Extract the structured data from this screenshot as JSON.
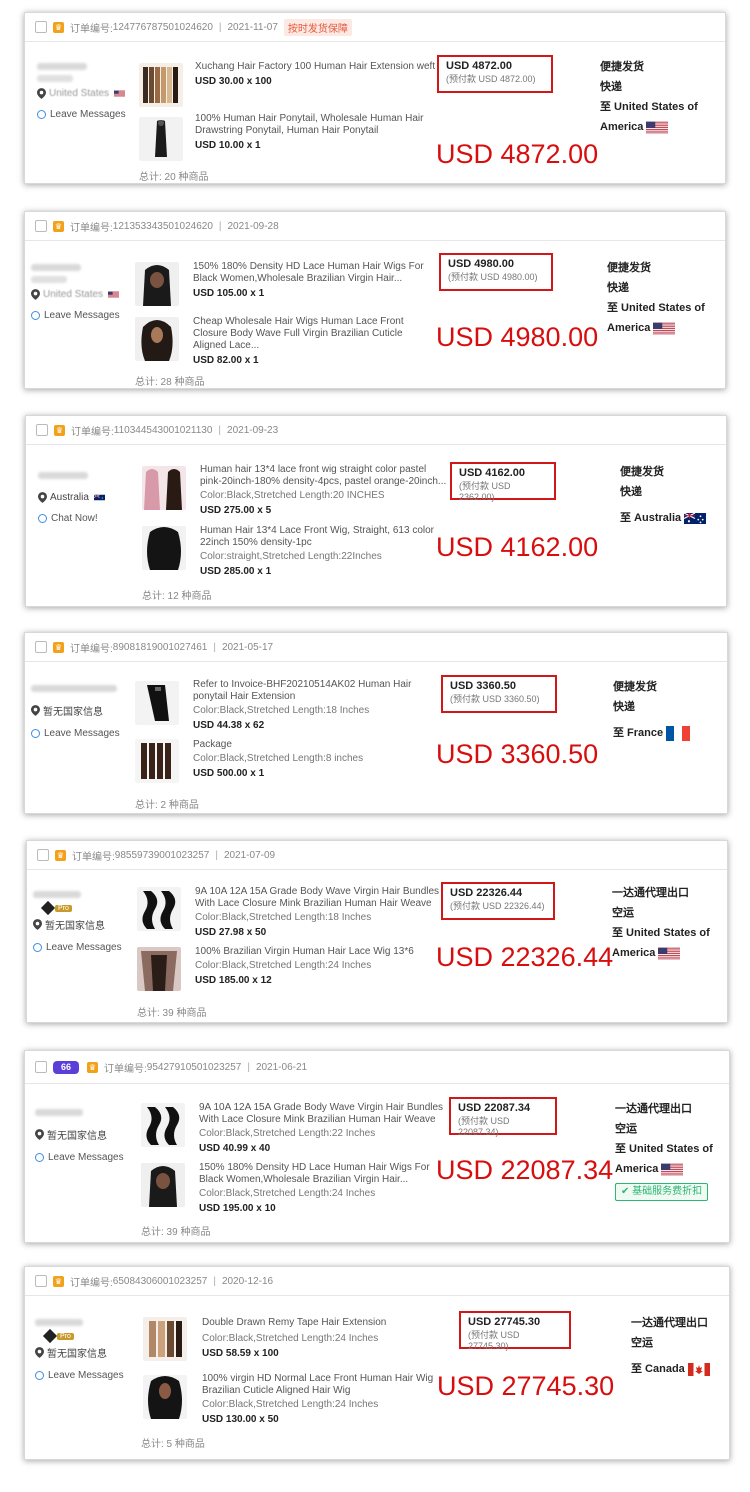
{
  "order_label": "订单编号:",
  "leave_messages": "Leave Messages",
  "chat_now": "Chat Now!",
  "ship_mode_a1": "便捷发货",
  "ship_mode_a2": "快递",
  "ship_mode_b1": "一达通代理出口",
  "ship_mode_b2": "空运",
  "no_country": "暂无国家信息",
  "pro_label": "Pro",
  "orders": [
    {
      "order_no": "124776787501024620",
      "date": "2021-11-07",
      "tag": "按时发货保障",
      "loc": "United States",
      "p1_title": "Xuchang Hair Factory 100 Human Hair Extension weft",
      "p1_attr": "",
      "p1_price": "USD 30.00 x 100",
      "p2_title": "100% Human Hair Ponytail, Wholesale Human Hair Drawstring Ponytail, Human Hair Ponytail",
      "p2_attr": "",
      "p2_price": "USD 10.00 x 1",
      "total": "总计: 20 种商品",
      "price_main": "USD 4872.00",
      "price_pre": "(预付款 USD 4872.00)",
      "big": "USD 4872.00",
      "dest": "至 United States of America"
    },
    {
      "order_no": "121353343501024620",
      "date": "2021-09-28",
      "loc": "United States",
      "p1_title": "150% 180% Density HD Lace Human Hair Wigs For Black Women,Wholesale Brazilian Virgin Hair...",
      "p1_attr": "",
      "p1_price": "USD 105.00 x 1",
      "p2_title": "Cheap Wholesale Hair Wigs Human Lace Front Closure Body Wave Full Virgin Brazilian Cuticle Aligned Lace...",
      "p2_attr": "",
      "p2_price": "USD 82.00 x 1",
      "total": "总计: 28 种商品",
      "price_main": "USD 4980.00",
      "price_pre": "(预付款 USD 4980.00)",
      "big": "USD 4980.00",
      "dest": "至 United States of America"
    },
    {
      "order_no": "110344543001021130",
      "date": "2021-09-23",
      "loc": "Australia",
      "p1_title": "Human hair 13*4 lace front wig straight color pastel pink-20inch-180% density-4pcs, pastel orange-20inch...",
      "p1_attr": "Color:Black,Stretched Length:20 INCHES",
      "p1_price": "USD 275.00 x 5",
      "p2_title": "Human Hair 13*4 Lace Front Wig, Straight, 613 color 22inch 150% density-1pc",
      "p2_attr": "Color:straight,Stretched Length:22Inches",
      "p2_price": "USD 285.00 x 1",
      "total": "总计: 12 种商品",
      "price_main": "USD 4162.00",
      "price_pre": "(预付款 USD 2362.00)",
      "big": "USD 4162.00",
      "dest": "至 Australia"
    },
    {
      "order_no": "89081819001027461",
      "date": "2021-05-17",
      "p1_title": "Refer to Invoice-BHF20210514AK02 Human Hair ponytail Hair Extension",
      "p1_attr": "Color:Black,Stretched Length:18 Inches",
      "p1_price": "USD 44.38 x 62",
      "p2_title": "Package",
      "p2_attr": "Color:Black,Stretched Length:8 inches",
      "p2_price": "USD 500.00 x 1",
      "total": "总计: 2 种商品",
      "price_main": "USD 3360.50",
      "price_pre": "(预付款 USD 3360.50)",
      "big": "USD 3360.50",
      "dest": "至 France"
    },
    {
      "order_no": "98559739001023257",
      "date": "2021-07-09",
      "p1_title": "9A 10A 12A 15A Grade Body Wave Virgin Hair Bundles With Lace Closure Mink Brazilian Human Hair Weave",
      "p1_attr": "Color:Black,Stretched Length:18 Inches",
      "p1_price": "USD 27.98 x 50",
      "p2_title": "100% Brazilian Virgin Human Hair Lace Wig 13*6",
      "p2_attr": "Color:Black,Stretched Length:24 Inches",
      "p2_price": "USD 185.00 x 12",
      "total": "总计: 39 种商品",
      "price_main": "USD 22326.44",
      "price_pre": "(预付款 USD 22326.44)",
      "big": "USD 22326.44",
      "dest": "至 United States of America"
    },
    {
      "order_no": "95427910501023257",
      "date": "2021-06-21",
      "p1_title": "9A 10A 12A 15A Grade Body Wave Virgin Hair Bundles With Lace Closure Mink Brazilian Human Hair Weave",
      "p1_attr": "Color:Black,Stretched Length:22 Inches",
      "p1_price": "USD 40.99 x 40",
      "p2_title": "150% 180% Density HD Lace Human Hair Wigs For Black Women,Wholesale Brazilian Virgin Hair...",
      "p2_attr": "Color:Black,Stretched Length:24 Inches",
      "p2_price": "USD 195.00 x 10",
      "total": "总计: 39 种商品",
      "price_main": "USD 22087.34",
      "price_pre": "(预付款 USD 22087.34)",
      "big": "USD 22087.34",
      "dest": "至 United States of America",
      "discount": "基础服务费折扣"
    },
    {
      "order_no": "65084306001023257",
      "date": "2020-12-16",
      "p1_title": "Double Drawn Remy Tape Hair Extension",
      "p1_attr": "Color:Black,Stretched Length:24 Inches",
      "p1_price": "USD 58.59 x 100",
      "p2_title": "100% virgin HD Normal Lace Front Human Hair Wig Brazilian Cuticle Aligned Hair Wig",
      "p2_attr": "Color:Black,Stretched Length:24 Inches",
      "p2_price": "USD 130.00 x 50",
      "total": "总计: 5 种商品",
      "price_main": "USD 27745.30",
      "price_pre": "(预付款 USD 27745.30)",
      "big": "USD 27745.30",
      "dest": "至 Canada"
    }
  ],
  "colors": {
    "accent_red": "#d80d0d",
    "crown": "#f2a11a",
    "badge66": "#5b3fd6",
    "discount_green": "#2bb673"
  },
  "badge66_text": "66"
}
